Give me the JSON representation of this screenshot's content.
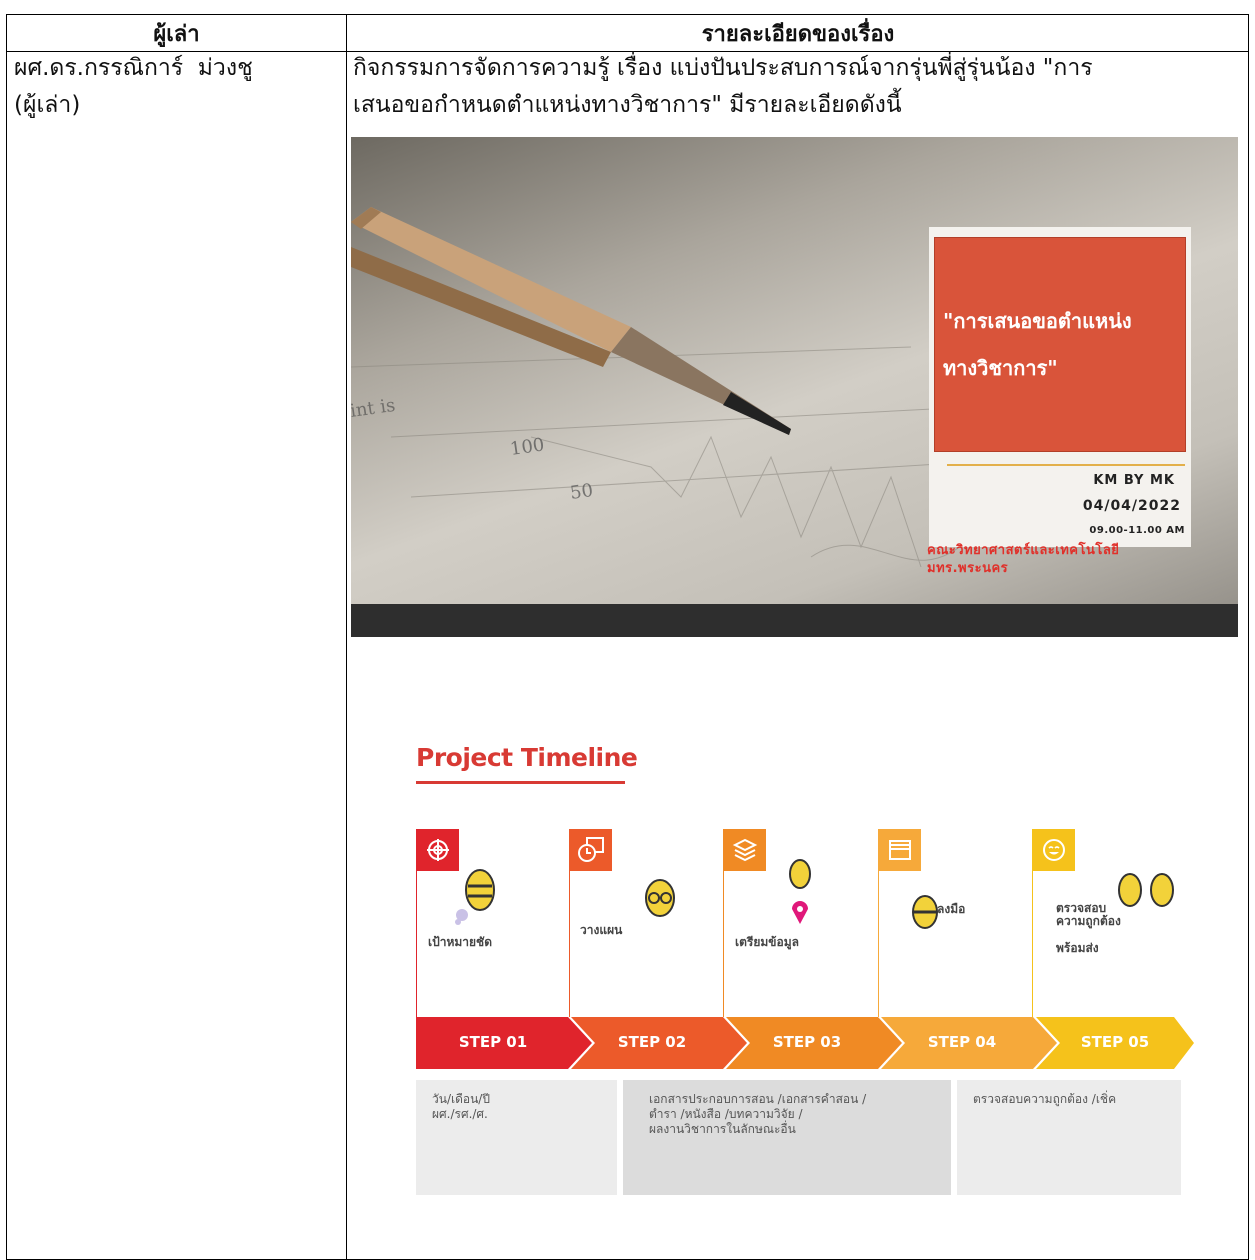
{
  "table": {
    "header_narrator": "ผู้เล่า",
    "header_details": "รายละเอียดของเรื่อง",
    "narrator_name": "ผศ.ดร.กรรณิการ์  ม่วงชู",
    "narrator_role": "(ผู้เล่า)",
    "story_line1": "กิจกรรมการจัดการความรู้ เรื่อง แบ่งปันประสบการณ์จากรุ่นพี่สู่รุ่นน้อง \"การ",
    "story_line2": "เสนอขอกำหนดตำแหน่งทางวิชาการ\" มีรายละเอียดดังนี้"
  },
  "cover": {
    "title_line1": "\"การเสนอขอตำแหน่ง",
    "title_line2": "ทางวิชาการ\"",
    "km": "KM BY MK",
    "date": "04/04/2022",
    "time": "09.00-11.00 AM",
    "faculty_line1": "คณะวิทยาศาสตร์และเทคโนโลยี",
    "faculty_line2": "มทร.พระนคร",
    "colors": {
      "card_red": "#d9543a",
      "accent_line": "#e3b04b",
      "faculty_text": "#e0302a"
    }
  },
  "timeline": {
    "title": "Project Timeline",
    "steps": [
      {
        "label": "STEP 01",
        "caption": "เป้าหมายชัด",
        "color": "#e0242c",
        "icon": "target-icon"
      },
      {
        "label": "STEP 02",
        "caption": "วางแผน",
        "color": "#ec5a2a",
        "icon": "calendar-clock-icon"
      },
      {
        "label": "STEP 03",
        "caption": "เตรียมข้อมูล",
        "color": "#f08a24",
        "icon": "books-icon"
      },
      {
        "label": "STEP 04",
        "caption": "ลงมือ",
        "color": "#f6a93a",
        "icon": "clapperboard-icon"
      },
      {
        "label": "STEP 05",
        "caption_line1": "ตรวจสอบ",
        "caption_line2": "ความถูกต้อง",
        "caption_line3": "พร้อมส่ง",
        "color": "#f5c21b",
        "icon": "smile-icon"
      }
    ],
    "notes": {
      "box1_line1": "วัน/เดือน/ปี",
      "box1_line2": "ผศ./รศ./ศ.",
      "box2_line1": "เอกสารประกอบการสอน /เอกสารคำสอน /",
      "box2_line2": "ตำรา /หนังสือ /บทความวิจัย /",
      "box2_line3": "ผลงานวิชาการในลักษณะอื่น",
      "box3_line1": "ตรวจสอบความถูกต้อง /เชิ่ค"
    }
  }
}
